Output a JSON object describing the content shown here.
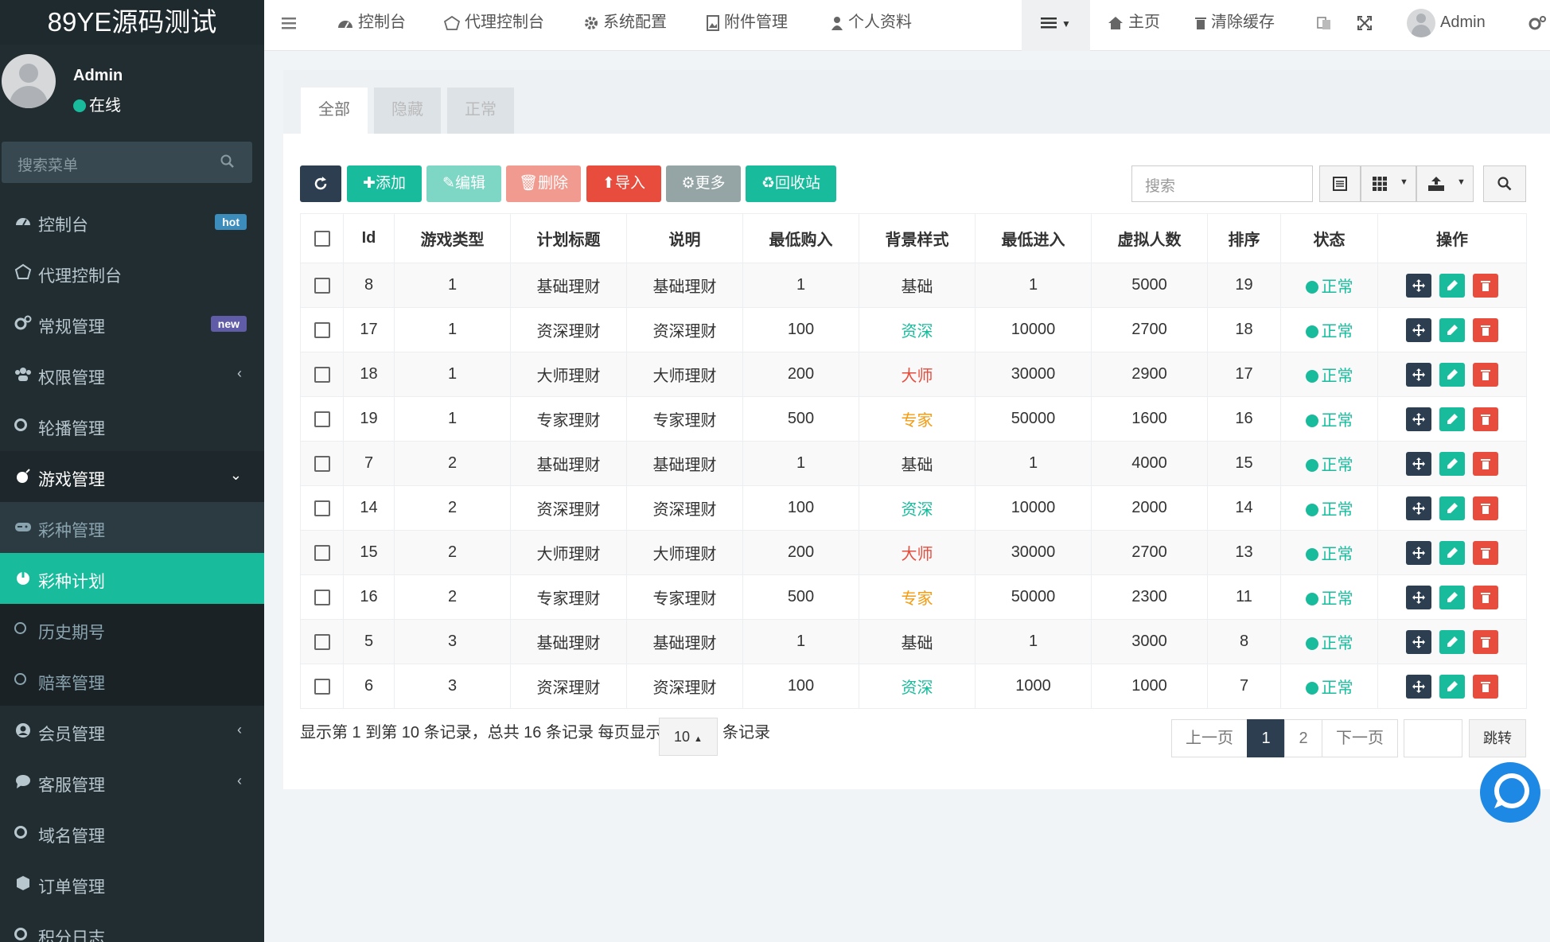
{
  "app": {
    "logo": "89YE源码测试"
  },
  "user": {
    "name": "Admin",
    "status": "在线"
  },
  "sidebar_search": {
    "placeholder": "搜索菜单"
  },
  "menu": [
    {
      "label": "控制台",
      "icon": "dashboard-icon",
      "badge": "hot"
    },
    {
      "label": "代理控制台",
      "icon": "gem-icon"
    },
    {
      "label": "常规管理",
      "icon": "gears-icon",
      "badge": "new"
    },
    {
      "label": "权限管理",
      "icon": "users-icon"
    },
    {
      "label": "轮播管理",
      "icon": "circle-icon"
    },
    {
      "label": "游戏管理",
      "icon": "bomb-icon"
    },
    {
      "label": "彩种管理",
      "icon": "gamepad-icon"
    },
    {
      "label": "彩种计划",
      "icon": "power-icon"
    },
    {
      "label": "历史期号",
      "icon": "circle-icon"
    },
    {
      "label": "赔率管理",
      "icon": "circle-icon"
    },
    {
      "label": "会员管理",
      "icon": "user-circle-icon"
    },
    {
      "label": "客服管理",
      "icon": "comment-icon"
    },
    {
      "label": "域名管理",
      "icon": "circle-icon"
    },
    {
      "label": "订单管理",
      "icon": "cube-icon"
    },
    {
      "label": "积分日志",
      "icon": "circle-icon"
    }
  ],
  "topnav": {
    "items": [
      "控制台",
      "代理控制台",
      "系统配置",
      "附件管理",
      "个人资料"
    ],
    "home": "主页",
    "clear_cache": "清除缓存",
    "admin": "Admin"
  },
  "tabs": [
    "全部",
    "隐藏",
    "正常"
  ],
  "toolbar": {
    "add": "添加",
    "edit": "编辑",
    "delete": "删除",
    "import": "导入",
    "more": "更多",
    "recycle": "回收站",
    "search_placeholder": "搜索"
  },
  "table": {
    "headers": [
      "Id",
      "游戏类型",
      "计划标题",
      "说明",
      "最低购入",
      "背景样式",
      "最低进入",
      "虚拟人数",
      "排序",
      "状态",
      "操作"
    ],
    "rows": [
      {
        "id": "8",
        "type": "1",
        "title": "基础理财",
        "desc": "基础理财",
        "min_buy": "1",
        "bg": "基础",
        "min_enter": "1",
        "virtual": "5000",
        "sort": "19",
        "status": "正常"
      },
      {
        "id": "17",
        "type": "1",
        "title": "资深理财",
        "desc": "资深理财",
        "min_buy": "100",
        "bg": "资深",
        "min_enter": "10000",
        "virtual": "2700",
        "sort": "18",
        "status": "正常"
      },
      {
        "id": "18",
        "type": "1",
        "title": "大师理财",
        "desc": "大师理财",
        "min_buy": "200",
        "bg": "大师",
        "min_enter": "30000",
        "virtual": "2900",
        "sort": "17",
        "status": "正常"
      },
      {
        "id": "19",
        "type": "1",
        "title": "专家理财",
        "desc": "专家理财",
        "min_buy": "500",
        "bg": "专家",
        "min_enter": "50000",
        "virtual": "1600",
        "sort": "16",
        "status": "正常"
      },
      {
        "id": "7",
        "type": "2",
        "title": "基础理财",
        "desc": "基础理财",
        "min_buy": "1",
        "bg": "基础",
        "min_enter": "1",
        "virtual": "4000",
        "sort": "15",
        "status": "正常"
      },
      {
        "id": "14",
        "type": "2",
        "title": "资深理财",
        "desc": "资深理财",
        "min_buy": "100",
        "bg": "资深",
        "min_enter": "10000",
        "virtual": "2000",
        "sort": "14",
        "status": "正常"
      },
      {
        "id": "15",
        "type": "2",
        "title": "大师理财",
        "desc": "大师理财",
        "min_buy": "200",
        "bg": "大师",
        "min_enter": "30000",
        "virtual": "2700",
        "sort": "13",
        "status": "正常"
      },
      {
        "id": "16",
        "type": "2",
        "title": "专家理财",
        "desc": "专家理财",
        "min_buy": "500",
        "bg": "专家",
        "min_enter": "50000",
        "virtual": "2300",
        "sort": "11",
        "status": "正常"
      },
      {
        "id": "5",
        "type": "3",
        "title": "基础理财",
        "desc": "基础理财",
        "min_buy": "1",
        "bg": "基础",
        "min_enter": "1",
        "virtual": "3000",
        "sort": "8",
        "status": "正常"
      },
      {
        "id": "6",
        "type": "3",
        "title": "资深理财",
        "desc": "资深理财",
        "min_buy": "100",
        "bg": "资深",
        "min_enter": "1000",
        "virtual": "1000",
        "sort": "7",
        "status": "正常"
      }
    ]
  },
  "bg_colors": {
    "基础": "#333333",
    "资深": "#18bc9c",
    "大师": "#e74c3c",
    "专家": "#f39c12"
  },
  "pagination": {
    "info": "显示第 1 到第 10 条记录，总共 16 条记录 每页显示",
    "page_size": "10",
    "after": "条记录",
    "prev": "上一页",
    "pages": [
      "1",
      "2"
    ],
    "next": "下一页",
    "go": "跳转"
  },
  "colors": {
    "accent": "#18bc9c",
    "sidebar": "#222d32",
    "primary_dark": "#2c3e50",
    "danger": "#e74c3c"
  }
}
